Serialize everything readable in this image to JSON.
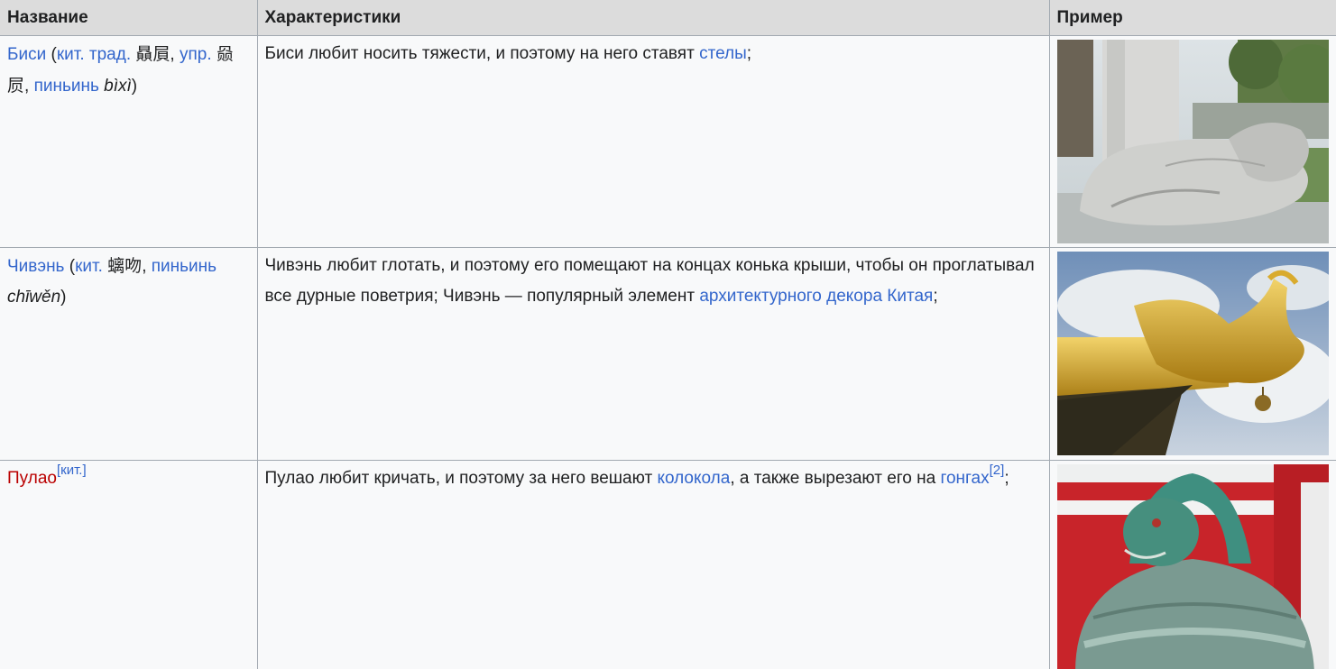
{
  "header": {
    "col1": "Название",
    "col2": "Характеристики",
    "col3": "Пример"
  },
  "rows": [
    {
      "name": "Биси",
      "paren_open": " (",
      "link_kit": "кит.",
      "link_trad": "трад.",
      "hanzi_trad": "贔屓",
      "comma1": ", ",
      "link_upr": "упр.",
      "hanzi_simp": "赑屃",
      "comma2": ", ",
      "link_pinyin": "пиньинь",
      "pinyin": "bìxì",
      "paren_close": ")",
      "desc_before": "Биси любит носить тяжести, и поэтому на него ставят ",
      "desc_link": "стелы",
      "desc_after": ";",
      "image_icon": "stone-turtle-photo"
    },
    {
      "name": "Чивэнь",
      "paren_open": " (",
      "link_kit": "кит.",
      "hanzi": "螭吻",
      "comma": ", ",
      "link_pinyin": "пиньинь",
      "pinyin": "chīwěn",
      "paren_close": ")",
      "desc_before": "Чивэнь любит глотать, и поэтому его помещают на концах конька крыши, чтобы он проглатывал все дурные поветрия; Чивэнь — популярный элемент ",
      "desc_link": "архитектурного декора Китая",
      "desc_after": ";",
      "image_icon": "golden-dragon-roof-photo"
    },
    {
      "name": "Пулао",
      "name_sup": "[кит.]",
      "desc_before": "Пулао любит кричать, и поэтому за него вешают ",
      "desc_link1": "колокола",
      "desc_mid": ", а также вырезают его на ",
      "desc_link2": "гонгах",
      "desc_sup": "[2]",
      "desc_after": ";",
      "image_icon": "bronze-bell-dragon-photo"
    }
  ],
  "colors": {
    "link": "#3366cc",
    "red_link": "#ba0000",
    "header_bg": "#dcdcdc",
    "row_bg": "#f8f9fa",
    "border": "#a2a9b1"
  }
}
